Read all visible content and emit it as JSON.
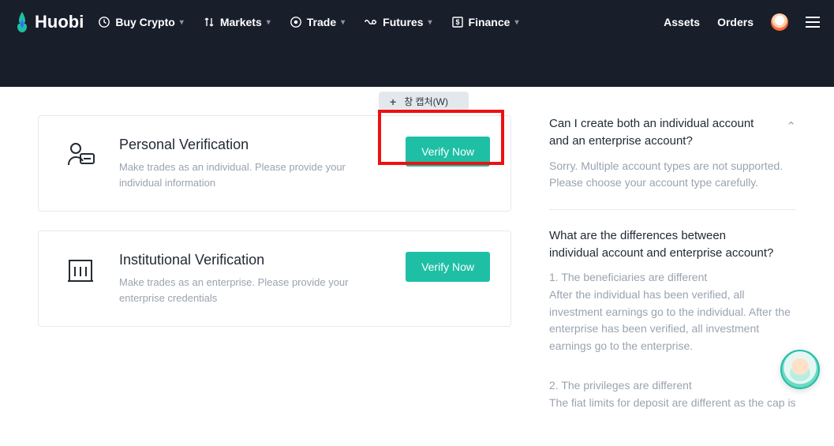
{
  "brand": "Huobi",
  "nav": {
    "items": [
      {
        "label": "Buy Crypto"
      },
      {
        "label": "Markets"
      },
      {
        "label": "Trade"
      },
      {
        "label": "Futures"
      },
      {
        "label": "Finance"
      }
    ]
  },
  "right": {
    "assets": "Assets",
    "orders": "Orders"
  },
  "capture_overlay": "창 캡처(W)",
  "cards": {
    "personal": {
      "title": "Personal Verification",
      "desc": "Make trades as an individual. Please provide your individual information",
      "button": "Verify Now"
    },
    "institutional": {
      "title": "Institutional Verification",
      "desc": "Make trades as an enterprise. Please provide your enterprise credentials",
      "button": "Verify Now"
    }
  },
  "faq": {
    "q1": {
      "question": "Can I create both an individual account and an enterprise account?",
      "answer": "Sorry. Multiple account types are not supported. Please choose your account type carefully."
    },
    "q2": {
      "question": "What are the differences between individual account and enterprise account?",
      "p1_title": "1. The beneficiaries are different",
      "p1_body": "After the individual has been verified, all investment earnings go to the individual. After the enterprise has been verified, all investment earnings go to the enterprise.",
      "p2_title": "2. The privileges are different",
      "p2_body": "The fiat limits for deposit are different as the cap is"
    }
  }
}
